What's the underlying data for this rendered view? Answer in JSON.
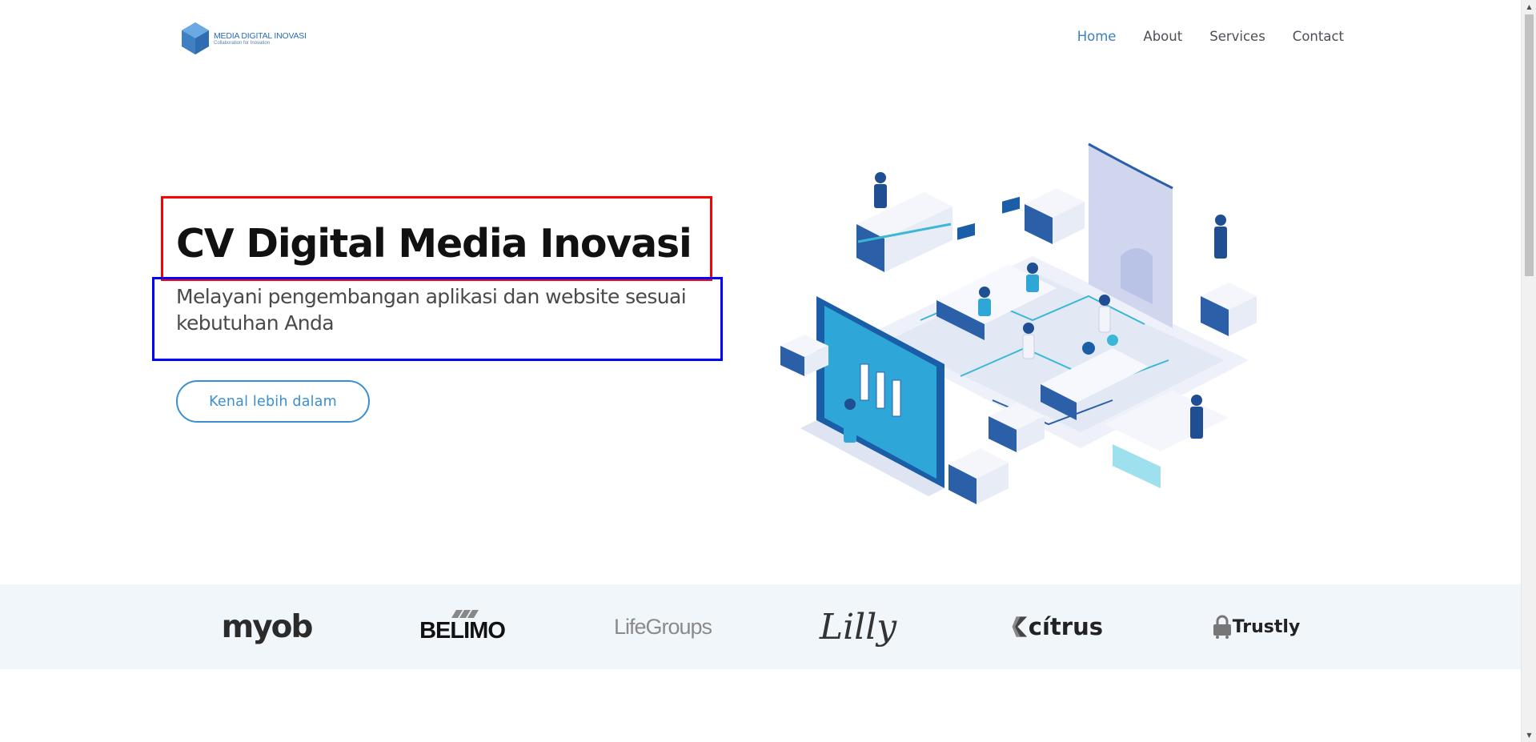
{
  "header": {
    "logo": {
      "title": "MEDIA DIGITAL INOVASI",
      "tagline": "Collaboration for Inovation",
      "icon": "hexagon-cube-logo"
    },
    "nav": [
      {
        "label": "Home",
        "active": true
      },
      {
        "label": "About",
        "active": false
      },
      {
        "label": "Services",
        "active": false
      },
      {
        "label": "Contact",
        "active": false
      }
    ]
  },
  "hero": {
    "title": "CV Digital Media Inovasi",
    "subtitle": "Melayani pengembangan aplikasi dan website sesuai kebutuhan Anda",
    "cta_label": "Kenal lebih dalam",
    "illustration": "isometric-tech-lab-illustration"
  },
  "clients": {
    "logos": [
      "myob",
      "BELIMO",
      "LifeGroups",
      "Lilly",
      "cítrus",
      "Trustly"
    ]
  },
  "colors": {
    "accent": "#3a8fd2",
    "nav_active": "#3a7ec8",
    "clients_band": "#f1f6fb",
    "annotation_red": "#ff0000",
    "annotation_blue": "#0000ff"
  }
}
